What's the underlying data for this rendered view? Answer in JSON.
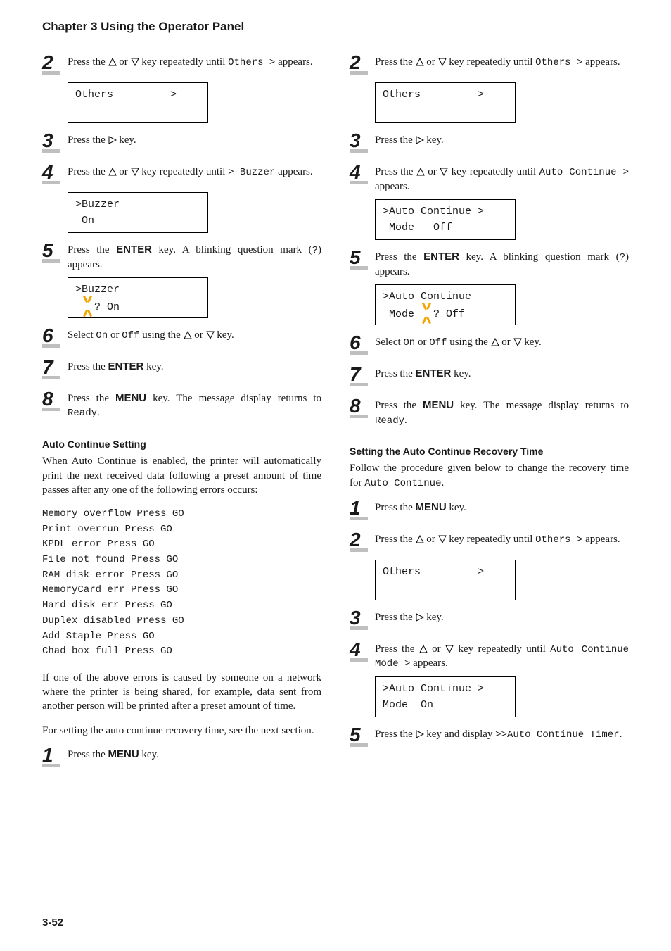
{
  "chapter": "Chapter 3  Using the Operator Panel",
  "footer": "3-52",
  "glyph": {
    "up": "△",
    "down": "▽",
    "right": "▷"
  },
  "left": {
    "s2": {
      "pre": "Press the ",
      "mid": " or ",
      "post": " key repeatedly until ",
      "code": "Others  >",
      "tail": " appears.",
      "box": "Others         >"
    },
    "s3": {
      "pre": "Press the ",
      "post": " key."
    },
    "s4": {
      "pre": "Press the ",
      "mid": " or ",
      "post": " key repeatedly until ",
      "code": "> Buzzer",
      "tail": " appears.",
      "box": ">Buzzer\n On"
    },
    "s5": {
      "pre": "Press the ",
      "bold": "ENTER",
      "post": " key. A blinking question mark (",
      "code": "?",
      "tail": ") appears.",
      "box": ">Buzzer\n ? On"
    },
    "s6": {
      "pre": "Select ",
      "c1": "On",
      "mid": " or ",
      "c2": "Off",
      "post": " using the ",
      "end": " or ",
      "k": " key."
    },
    "s7": {
      "pre": "Press the ",
      "bold": "ENTER",
      "post": " key."
    },
    "s8": {
      "pre": "Press the ",
      "bold": "MENU",
      "post": " key. The message display returns to ",
      "code": "Ready",
      "tail": "."
    },
    "sect": "Auto Continue Setting",
    "p1": "When Auto Continue is enabled, the printer will automatically print the next received data following a preset amount of time passes after any one of the following errors occurs:",
    "errs": "Memory overflow Press GO\nPrint overrun Press GO\nKPDL error Press GO\nFile not found Press GO\nRAM disk error Press GO\nMemoryCard err Press GO\nHard disk err Press GO\nDuplex disabled Press GO\nAdd Staple Press GO\nChad box full Press GO",
    "p2": "If one of the above errors is caused by someone on a network where the printer is being shared, for example, data sent from another person will be printed after a preset amount of time.",
    "p3": "For setting the auto continue recovery time, see the next section.",
    "s1": {
      "pre": "Press the ",
      "bold": "MENU",
      "post": " key."
    }
  },
  "right": {
    "s2": {
      "pre": "Press the ",
      "mid": " or ",
      "post": " key repeatedly until ",
      "code": "Others  >",
      "tail": " appears.",
      "box": "Others         >"
    },
    "s3": {
      "pre": "Press the ",
      "post": " key."
    },
    "s4": {
      "pre": "Press the ",
      "mid": " or ",
      "post": " key repeatedly until ",
      "code": "Auto Continue >",
      "tail": " appears.",
      "box": ">Auto Continue >\n Mode   Off"
    },
    "s5": {
      "pre": "Press the ",
      "bold": "ENTER",
      "post": " key. A blinking question mark (",
      "code": "?",
      "tail": ") appears.",
      "box": ">Auto Continue\n Mode ? Off"
    },
    "s6": {
      "pre": "Select ",
      "c1": "On",
      "mid": " or ",
      "c2": "Off",
      "post": " using the ",
      "end": " or ",
      "k": " key."
    },
    "s7": {
      "pre": "Press the ",
      "bold": "ENTER",
      "post": " key."
    },
    "s8": {
      "pre": "Press the ",
      "bold": "MENU",
      "post": " key. The message display returns to ",
      "code": "Ready",
      "tail": "."
    },
    "sect": "Setting the Auto Continue Recovery Time",
    "p1": "Follow the procedure given below to change the recovery time for ",
    "p1code": "Auto Continue",
    "b1": {
      "pre": "Press the ",
      "bold": "MENU",
      "post": " key."
    },
    "b2": {
      "pre": "Press the ",
      "mid": " or ",
      "post": " key repeatedly until ",
      "code": "Others  >",
      "tail": " appears.",
      "box": "Others         >"
    },
    "b3": {
      "pre": "Press the ",
      "post": " key."
    },
    "b4": {
      "pre": "Press the ",
      "mid": " or ",
      "post": " key repeatedly until ",
      "code": "Auto Continue Mode >",
      "tail": " appears.",
      "box": ">Auto Continue >\nMode  On"
    },
    "b5": {
      "pre": "Press the ",
      "post": " key and display ",
      "code": ">>Auto  Continue Timer",
      "tail": "."
    }
  }
}
